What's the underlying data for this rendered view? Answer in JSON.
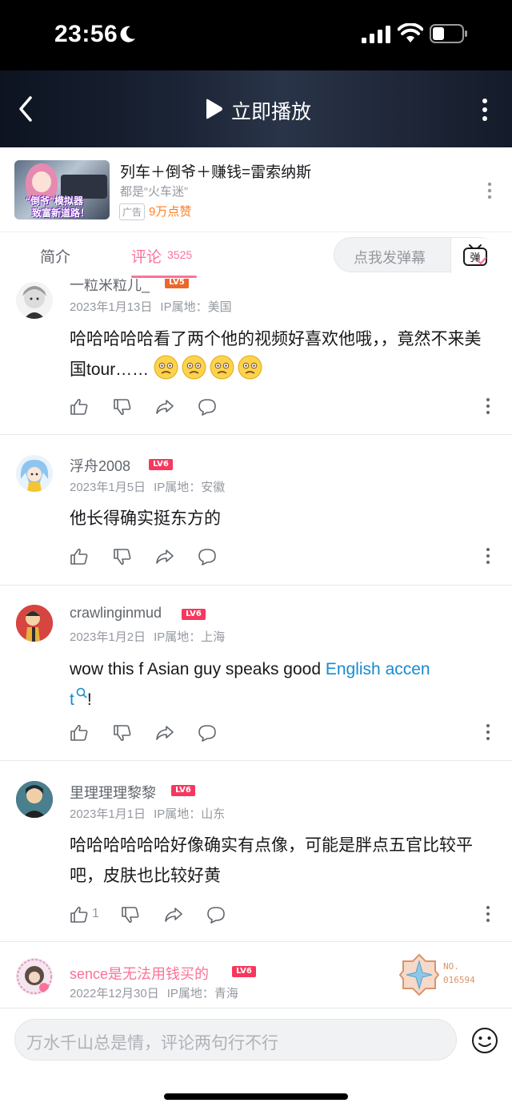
{
  "status_bar": {
    "time": "23:56"
  },
  "player": {
    "play_label": "立即播放"
  },
  "ad": {
    "thumb_caption_1": "“倒爷”模拟器",
    "thumb_caption_2": "致富新道路！",
    "title": "列车＋倒爷＋赚钱=雷索纳斯",
    "subtitle": "都是“火车迷”",
    "tag": "广告",
    "likes": "9万点赞"
  },
  "tabs": {
    "intro": "简介",
    "comments": "评论",
    "comments_count": "3525",
    "danmaku_placeholder": "点我发弹幕",
    "danmaku_button": "弹"
  },
  "comments": [
    {
      "username": "一粒米粒儿_",
      "level": "LV5",
      "date": "2023年1月13日",
      "ip": "IP属地：美国",
      "text": "哈哈哈哈哈看了两个他的视频好喜欢他哦，，竟然不来美国tour……",
      "likes": ""
    },
    {
      "username": "浮舟2008",
      "level": "LV6",
      "date": "2023年1月5日",
      "ip": "IP属地：安徽",
      "text": "他长得确实挺东方的",
      "likes": ""
    },
    {
      "username": "crawlinginmud",
      "level": "LV6",
      "date": "2023年1月2日",
      "ip": "IP属地：上海",
      "text_before": "wow this f  Asian  guy speaks good ",
      "text_link_1": "English accen",
      "text_link_2": "t",
      "text_after": "!",
      "likes": ""
    },
    {
      "username": "里理理理黎黎",
      "level": "LV6",
      "date": "2023年1月1日",
      "ip": "IP属地：山东",
      "text": "哈哈哈哈哈哈好像确实有点像，可能是胖点五官比较平吧，皮肤也比较好黄",
      "likes": "1"
    },
    {
      "username": "sence是无法用钱买的",
      "level": "LV6",
      "date": "2022年12月30日",
      "ip": "IP属地：青海",
      "badge_label": "NO.",
      "badge_number": "016594"
    }
  ],
  "bottom": {
    "placeholder": "万水千山总是情，评论两句行不行"
  },
  "colors": {
    "accent": "#fb7299",
    "link": "#178bcf",
    "lv5": "#ee672a",
    "lv6": "#f6385e"
  },
  "icons": [
    "moon-icon",
    "signal-icon",
    "wifi-icon",
    "battery-icon",
    "back-icon",
    "play-icon",
    "more-icon",
    "danmaku-icon",
    "like-icon",
    "dislike-icon",
    "share-icon",
    "reply-icon",
    "emoji-icon"
  ]
}
